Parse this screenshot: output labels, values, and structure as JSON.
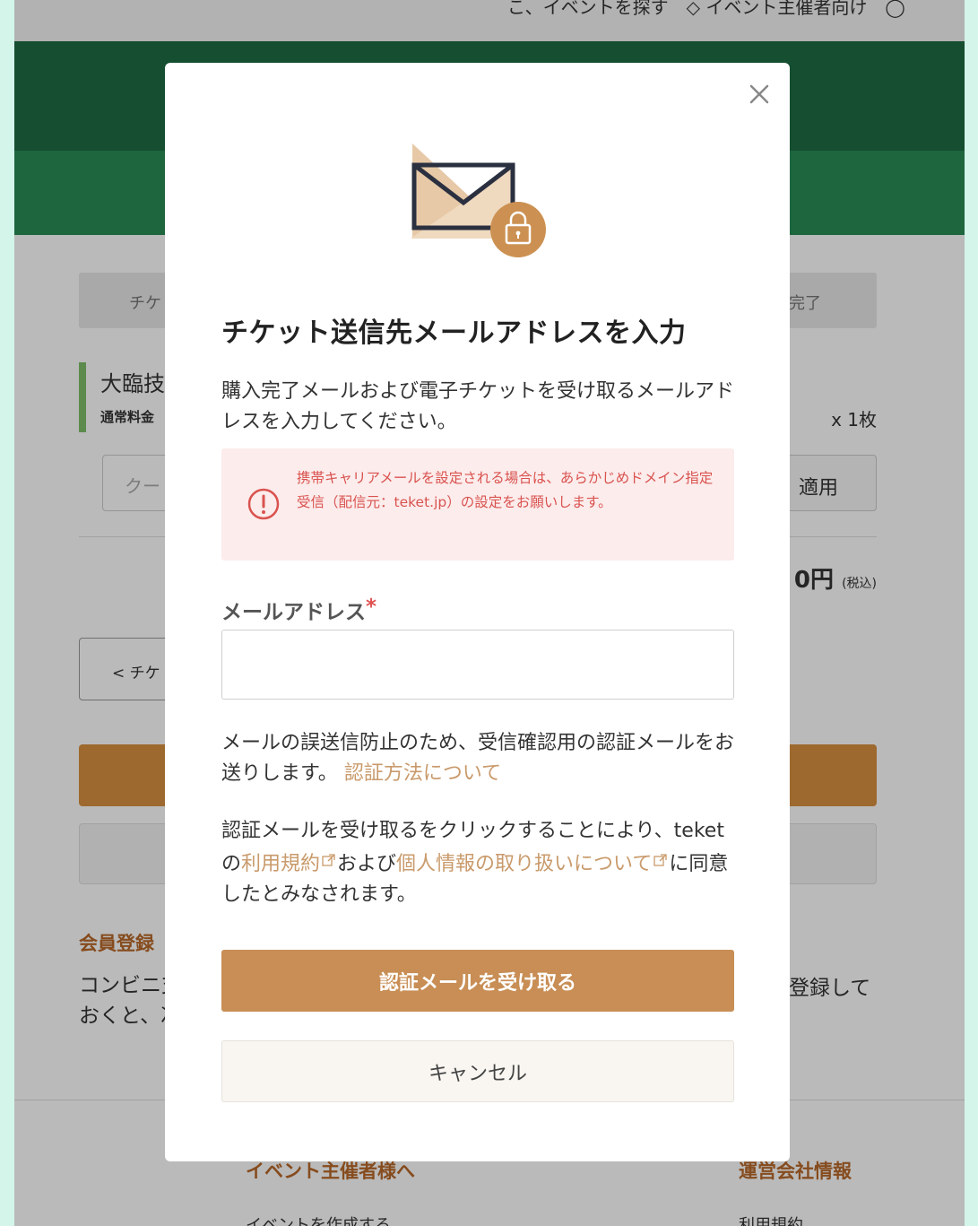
{
  "background": {
    "top_strip_text": "こ、イベントを探す　◇ イベント主催者向け　◯",
    "steps": {
      "left_label": "チケ",
      "right_label": "完了"
    },
    "ticket": {
      "name": "大臨技",
      "sub": "通常料金",
      "count": "x 1枚"
    },
    "coupon": {
      "placeholder": "クー",
      "apply_label": "適用"
    },
    "total": {
      "amount": "0円",
      "tax": "(税込)"
    },
    "back_button": "< チケ",
    "member": {
      "title": "会員登録",
      "text_left": "コンビニ支\nおくと、次",
      "text_right": "登録して"
    },
    "footer": {
      "left_title": "イベント主催者様へ",
      "right_title": "運営会社情報",
      "left_sub": "イベントを作成する",
      "right_sub": "利用規約"
    }
  },
  "modal": {
    "title": "チケット送信先メールアドレスを入力",
    "description": "購入完了メールおよび電子チケットを受け取るメールアドレスを入力してください。",
    "alert": "携帯キャリアメールを設定される場合は、あらかじめドメイン指定受信（配信元：teket.jp）の設定をお願いします。",
    "email_label": "メールアドレス",
    "required_mark": "*",
    "email_value": "",
    "verify_text": "メールの誤送信防止のため、受信確認用の認証メールをお送りします。",
    "verify_link": "認証方法について",
    "consent_prefix": "認証メールを受け取るをクリックすることにより、teketの",
    "terms_link": "利用規約",
    "consent_and": "および",
    "privacy_link": "個人情報の取り扱いについて",
    "consent_suffix": "に同意したとみなされます。",
    "primary_button": "認証メールを受け取る",
    "cancel_button": "キャンセル"
  },
  "colors": {
    "accent": "#c88e55",
    "link": "#c99a6b",
    "alert_bg": "#fcecec",
    "alert_text": "#d9534f",
    "header_green": "#1d6b43"
  },
  "icons": [
    "envelope-lock-icon",
    "close-icon",
    "exclamation-circle-icon",
    "external-link-icon"
  ]
}
